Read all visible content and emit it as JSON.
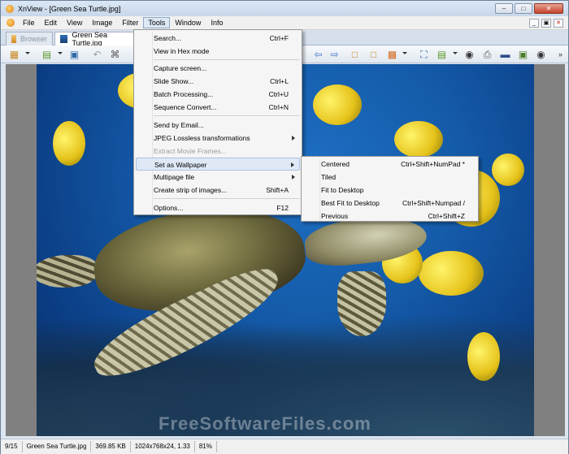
{
  "window": {
    "title": "XnView - [Green Sea Turtle.jpg]"
  },
  "menubar": {
    "items": [
      "File",
      "Edit",
      "View",
      "Image",
      "Filter",
      "Tools",
      "Window",
      "Info"
    ],
    "active": "Tools"
  },
  "tabs": [
    {
      "label": "Browser",
      "active": false
    },
    {
      "label": "Green Sea Turtle.jpg",
      "active": true
    }
  ],
  "tools_menu": {
    "items": [
      {
        "label": "Search...",
        "shortcut": "Ctrl+F"
      },
      {
        "label": "View in Hex mode",
        "shortcut": ""
      },
      {
        "label": "Capture screen...",
        "shortcut": ""
      },
      {
        "label": "Slide Show...",
        "shortcut": "Ctrl+L"
      },
      {
        "label": "Batch Processing...",
        "shortcut": "Ctrl+U"
      },
      {
        "label": "Sequence Convert...",
        "shortcut": "Ctrl+N"
      },
      {
        "label": "Send by Email...",
        "shortcut": ""
      },
      {
        "label": "JPEG Lossless transformations",
        "shortcut": ""
      },
      {
        "label": "Extract Movie Frames...",
        "shortcut": ""
      },
      {
        "label": "Set as Wallpaper",
        "shortcut": ""
      },
      {
        "label": "Multipage file",
        "shortcut": ""
      },
      {
        "label": "Create strip of images...",
        "shortcut": "Shift+A"
      },
      {
        "label": "Options...",
        "shortcut": "F12"
      }
    ]
  },
  "wallpaper_menu": {
    "items": [
      {
        "label": "Centered",
        "shortcut": "Ctrl+Shift+NumPad *"
      },
      {
        "label": "Tiled",
        "shortcut": ""
      },
      {
        "label": "Fit to Desktop",
        "shortcut": ""
      },
      {
        "label": "Best Fit to Desktop",
        "shortcut": "Ctrl+Shift+Numpad /"
      },
      {
        "label": "Previous",
        "shortcut": "Ctrl+Shift+Z"
      }
    ]
  },
  "statusbar": {
    "index": "9/15",
    "filename": "Green Sea Turtle.jpg",
    "filesize": "369.85 KB",
    "dimensions": "1024x768x24, 1.33",
    "zoom": "81%"
  },
  "watermark": "FreeSoftwareFiles.com",
  "icons": {
    "window_minimize": "minimize-icon",
    "window_maximize": "maximize-icon",
    "window_close": "close-icon"
  }
}
